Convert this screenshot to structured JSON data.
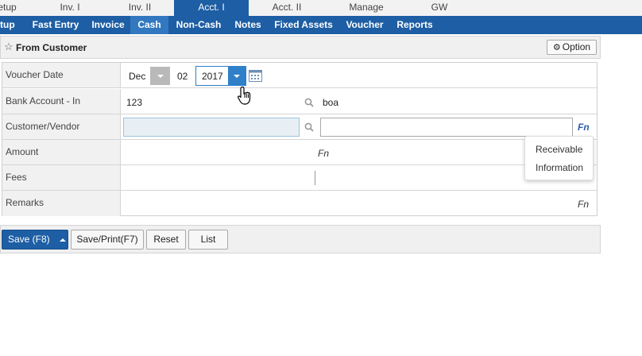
{
  "top_tabs": [
    {
      "label": "etup"
    },
    {
      "label": "Inv. I"
    },
    {
      "label": "Inv. II"
    },
    {
      "label": "Acct. I",
      "active": true
    },
    {
      "label": "Acct. II"
    },
    {
      "label": "Manage"
    },
    {
      "label": "GW"
    }
  ],
  "sub_nav": [
    {
      "label": "Setup"
    },
    {
      "label": "Fast Entry"
    },
    {
      "label": "Invoice"
    },
    {
      "label": "Cash",
      "active": true
    },
    {
      "label": "Non-Cash"
    },
    {
      "label": "Notes"
    },
    {
      "label": "Fixed Assets"
    },
    {
      "label": "Voucher"
    },
    {
      "label": "Reports"
    }
  ],
  "header": {
    "title": "From Customer",
    "option_label": "Option"
  },
  "form": {
    "voucher_date": {
      "label": "Voucher Date",
      "month": "Dec",
      "day": "02",
      "year": "2017"
    },
    "bank_account": {
      "label": "Bank Account - In",
      "code": "123",
      "name": "boa"
    },
    "customer_vendor": {
      "label": "Customer/Vendor",
      "code": "",
      "name": "",
      "fn": "Fn"
    },
    "amount": {
      "label": "Amount",
      "fn": "Fn"
    },
    "fees": {
      "label": "Fees"
    },
    "remarks": {
      "label": "Remarks",
      "fn": "Fn"
    }
  },
  "popup": {
    "items": [
      "Receivable",
      "Information"
    ]
  },
  "buttons": {
    "save": "Save (F8)",
    "save_print": "Save/Print(F7)",
    "reset": "Reset",
    "list": "List"
  },
  "colors": {
    "nav_blue": "#1d5ea4",
    "active_blue": "#2f7fc9",
    "label_bg": "#f1f1f1"
  }
}
